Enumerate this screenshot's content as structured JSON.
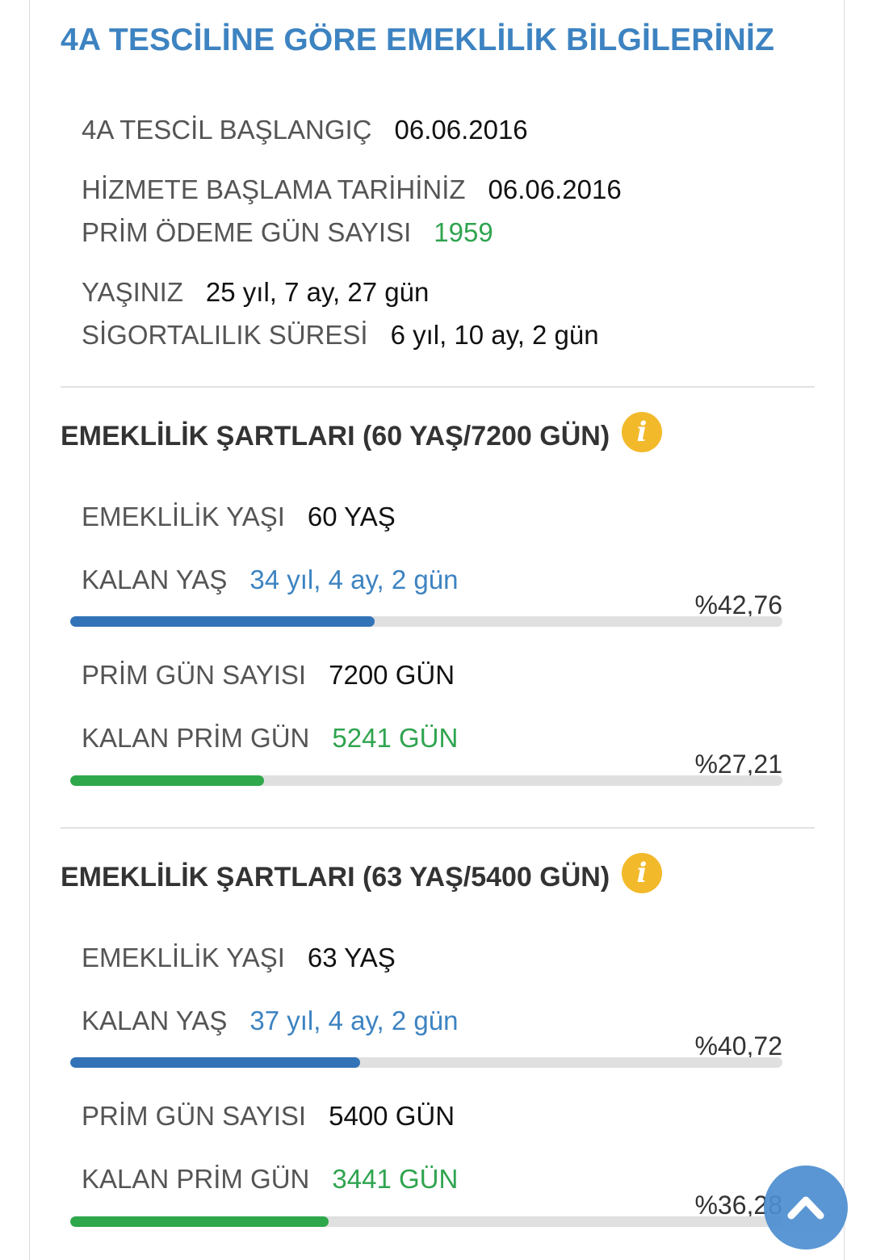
{
  "title": "4A TESCİLİNE GÖRE EMEKLİLİK BİLGİLERİNİZ",
  "info": {
    "tescil_label": "4A TESCİL BAŞLANGIÇ",
    "tescil_value": "06.06.2016",
    "hizmet_label": "HİZMETE BAŞLAMA TARİHİNİZ",
    "hizmet_value": "06.06.2016",
    "prim_label": "PRİM ÖDEME GÜN SAYISI",
    "prim_value": "1959",
    "yas_label": "YAŞINIZ",
    "yas_value": "25 yıl, 7 ay, 27 gün",
    "sigorta_label": "SİGORTALILIK SÜRESİ",
    "sigorta_value": "6 yıl, 10 ay, 2 gün"
  },
  "sections": [
    {
      "title": "EMEKLİLİK ŞARTLARI (60 YAŞ/7200 GÜN)",
      "emeklilik_yasi_label": "EMEKLİLİK YAŞI",
      "emeklilik_yasi_value": "60 YAŞ",
      "kalan_yas_label": "KALAN YAŞ",
      "kalan_yas_value": "34 yıl, 4 ay, 2 gün",
      "yas_percent_text": "%42,76",
      "yas_progress": 42.76,
      "prim_gun_label": "PRİM GÜN SAYISI",
      "prim_gun_value": "7200 GÜN",
      "kalan_prim_label": "KALAN PRİM GÜN",
      "kalan_prim_value": "5241 GÜN",
      "prim_percent_text": "%27,21",
      "prim_progress": 27.21
    },
    {
      "title": "EMEKLİLİK ŞARTLARI (63 YAŞ/5400 GÜN)",
      "emeklilik_yasi_label": "EMEKLİLİK YAŞI",
      "emeklilik_yasi_value": "63 YAŞ",
      "kalan_yas_label": "KALAN YAŞ",
      "kalan_yas_value": "37 yıl, 4 ay, 2 gün",
      "yas_percent_text": "%40,72",
      "yas_progress": 40.72,
      "prim_gun_label": "PRİM GÜN SAYISI",
      "prim_gun_value": "5400 GÜN",
      "kalan_prim_label": "KALAN PRİM GÜN",
      "kalan_prim_value": "3441 GÜN",
      "prim_percent_text": "%36,28",
      "prim_progress": 36.28
    }
  ],
  "icons": {
    "info": "info-icon",
    "scroll_top": "chevron-up-icon"
  },
  "colors": {
    "title": "#3d83c1",
    "blue_bar": "#3273b8",
    "green_bar": "#2ea84b",
    "green_text": "#2fa44f",
    "info_icon": "#f2b92a",
    "scroll_button": "#4d8ed0"
  }
}
